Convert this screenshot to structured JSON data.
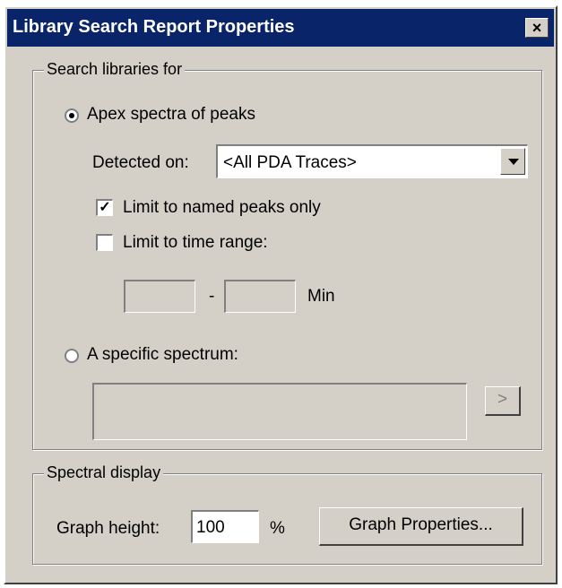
{
  "dialog": {
    "title": "Library Search Report Properties",
    "close_glyph": "×"
  },
  "search_group": {
    "legend": "Search libraries for",
    "apex_radio_label": "Apex spectra of peaks",
    "detected_on_label": "Detected on:",
    "detected_on_value": "<All PDA Traces>",
    "limit_named_label": "Limit to named peaks only",
    "limit_named_checked": true,
    "limit_time_label": "Limit to time range:",
    "limit_time_checked": false,
    "time_from": "",
    "time_separator": "-",
    "time_to": "",
    "time_unit": "Min",
    "specific_radio_label": "A specific spectrum:",
    "spectrum_value": "",
    "browse_button": ">"
  },
  "display_group": {
    "legend": "Spectral display",
    "graph_height_label": "Graph height:",
    "graph_height_value": "100",
    "percent_label": "%",
    "graph_properties_button": "Graph Properties..."
  },
  "icons": {
    "close": "close-icon",
    "dropdown": "chevron-down-icon",
    "check": "checkmark-icon"
  }
}
